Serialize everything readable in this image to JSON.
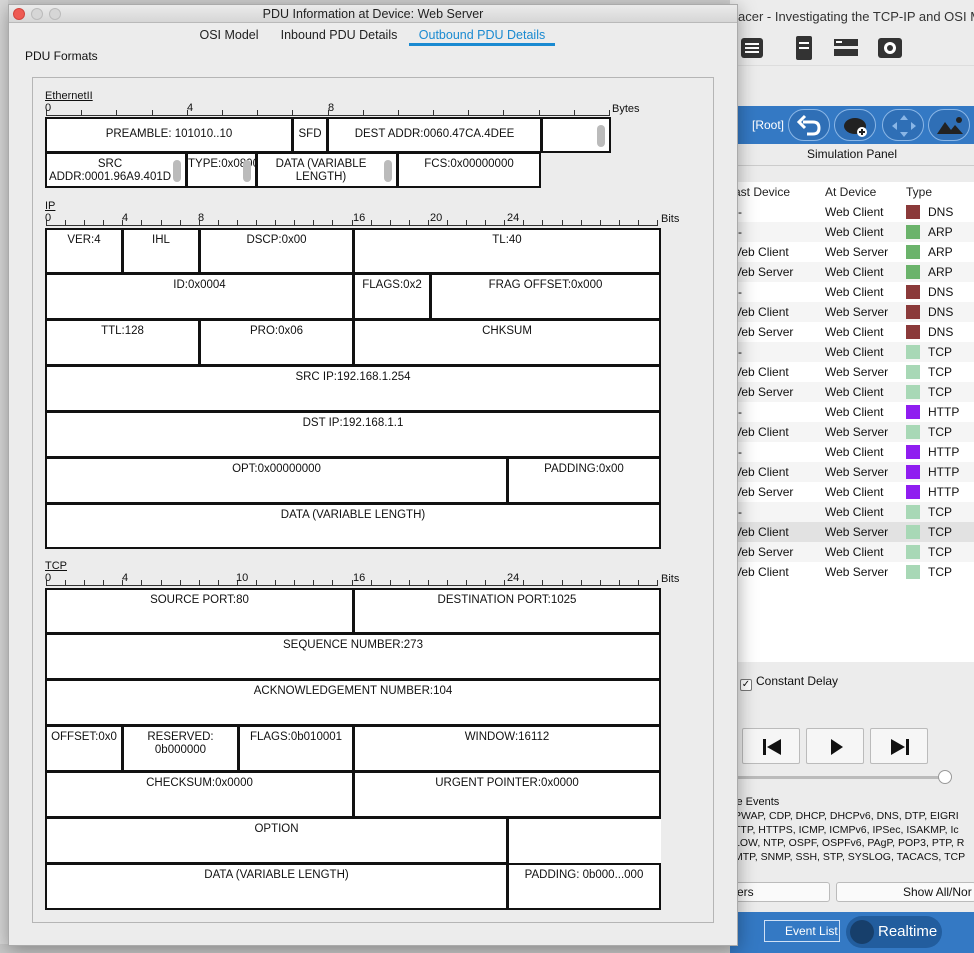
{
  "background_window": {
    "title": "acer - Investigating the TCP-IP and OSI M",
    "root_label": "[Root]",
    "simulation_panel_title": "Simulation Panel",
    "event_columns": [
      "ast Device",
      "At Device",
      "Type"
    ],
    "events": [
      {
        "last": "--",
        "at": "Web Client",
        "type": "DNS",
        "color": "#8b3a3a"
      },
      {
        "last": "--",
        "at": "Web Client",
        "type": "ARP",
        "color": "#6bb36b"
      },
      {
        "last": "Veb Client",
        "at": "Web Server",
        "type": "ARP",
        "color": "#6bb36b"
      },
      {
        "last": "Veb Server",
        "at": "Web Client",
        "type": "ARP",
        "color": "#6bb36b"
      },
      {
        "last": "--",
        "at": "Web Client",
        "type": "DNS",
        "color": "#8b3a3a"
      },
      {
        "last": "Veb Client",
        "at": "Web Server",
        "type": "DNS",
        "color": "#8b3a3a"
      },
      {
        "last": "Veb Server",
        "at": "Web Client",
        "type": "DNS",
        "color": "#8b3a3a"
      },
      {
        "last": "--",
        "at": "Web Client",
        "type": "TCP",
        "color": "#a8d8b6"
      },
      {
        "last": "Veb Client",
        "at": "Web Server",
        "type": "TCP",
        "color": "#a8d8b6"
      },
      {
        "last": "Veb Server",
        "at": "Web Client",
        "type": "TCP",
        "color": "#a8d8b6"
      },
      {
        "last": "--",
        "at": "Web Client",
        "type": "HTTP",
        "color": "#8f1df0"
      },
      {
        "last": "Veb Client",
        "at": "Web Server",
        "type": "TCP",
        "color": "#a8d8b6"
      },
      {
        "last": "--",
        "at": "Web Client",
        "type": "HTTP",
        "color": "#8f1df0"
      },
      {
        "last": "Veb Client",
        "at": "Web Server",
        "type": "HTTP",
        "color": "#8f1df0"
      },
      {
        "last": "Veb Server",
        "at": "Web Client",
        "type": "HTTP",
        "color": "#8f1df0"
      },
      {
        "last": "--",
        "at": "Web Client",
        "type": "TCP",
        "color": "#a8d8b6"
      },
      {
        "last": "Veb Client",
        "at": "Web Server",
        "type": "TCP",
        "color": "#a8d8b6"
      },
      {
        "last": "Veb Server",
        "at": "Web Client",
        "type": "TCP",
        "color": "#a8d8b6"
      },
      {
        "last": "Veb Client",
        "at": "Web Server",
        "type": "TCP",
        "color": "#a8d8b6"
      }
    ],
    "selected_event_index": 16,
    "constant_delay_label": "Constant Delay",
    "constant_delay_checked": "✓",
    "filters_title": "le Events",
    "filters_lines": [
      "PWAP, CDP, DHCP, DHCPv6, DNS, DTP, EIGRI",
      "TTP, HTTPS, ICMP, ICMPv6, IPSec, ISAKMP, Ic",
      "LOW, NTP, OSPF, OSPFv6, PAgP, POP3, PTP, R",
      "MTP, SNMP, SSH, STP, SYSLOG, TACACS, TCP"
    ],
    "edit_filters_label": "ers",
    "show_all_label": "Show All/Nor",
    "event_list_label": "Event List",
    "realtime_label": "Realtime"
  },
  "dialog": {
    "title": "PDU Information at Device: Web Server",
    "tabs": [
      "OSI Model",
      "Inbound PDU Details",
      "Outbound PDU Details"
    ],
    "active_tab": 2,
    "pdu_formats_label": "PDU Formats"
  },
  "ethernet": {
    "title": "EthernetII",
    "ruler_labels": [
      "0",
      "4",
      "8"
    ],
    "unit": "Bytes",
    "fields": {
      "preamble": "PREAMBLE: 101010..10",
      "sfd": "SFD",
      "dest_addr": "DEST ADDR:0060.47CA.4DEE",
      "src_addr": "SRC ADDR:0001.96A9.401D",
      "type": "TYPE:0x0800",
      "data": "DATA (VARIABLE LENGTH)",
      "fcs": "FCS:0x00000000"
    }
  },
  "ip": {
    "title": "IP",
    "ruler_labels": [
      "0",
      "4",
      "8",
      "16",
      "20",
      "24"
    ],
    "unit": "Bits",
    "fields": {
      "ver": "VER:4",
      "ihl": "IHL",
      "dscp": "DSCP:0x00",
      "tl": "TL:40",
      "id": "ID:0x0004",
      "flags": "FLAGS:0x2",
      "frag_offset": "FRAG OFFSET:0x000",
      "ttl": "TTL:128",
      "pro": "PRO:0x06",
      "chksum": "CHKSUM",
      "src_ip": "SRC IP:192.168.1.254",
      "dst_ip": "DST IP:192.168.1.1",
      "opt": "OPT:0x00000000",
      "padding": "PADDING:0x00",
      "data": "DATA (VARIABLE LENGTH)"
    }
  },
  "tcp": {
    "title": "TCP",
    "ruler_labels": [
      "0",
      "4",
      "10",
      "16",
      "24"
    ],
    "unit": "Bits",
    "fields": {
      "source_port": "SOURCE PORT:80",
      "destination_port": "DESTINATION PORT:1025",
      "sequence_number": "SEQUENCE NUMBER:273",
      "ack_number": "ACKNOWLEDGEMENT NUMBER:104",
      "offset": "OFFSET:0x0",
      "reserved": "RESERVED: 0b000000",
      "flags": "FLAGS:0b010001",
      "window": "WINDOW:16112",
      "checksum": "CHECKSUM:0x0000",
      "urgent_pointer": "URGENT POINTER:0x0000",
      "option": "OPTION",
      "data": "DATA (VARIABLE LENGTH)",
      "padding": "PADDING: 0b000...000"
    }
  }
}
